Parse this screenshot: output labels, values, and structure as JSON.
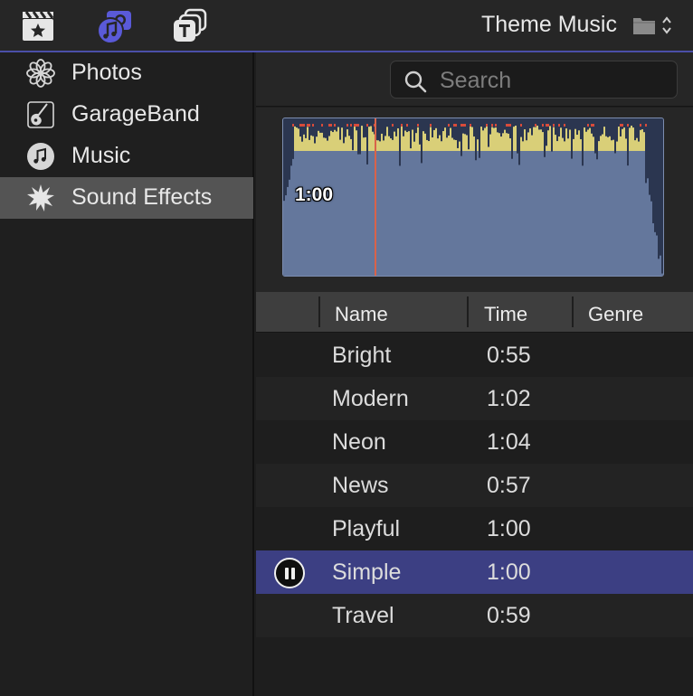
{
  "toolbar": {
    "tabs": [
      {
        "name": "movies-tab",
        "icon": "clapperboard-icon",
        "active": false
      },
      {
        "name": "audio-photos-tab",
        "icon": "camera-music-icon",
        "active": true
      },
      {
        "name": "titles-tab",
        "icon": "titles-icon",
        "active": false
      }
    ],
    "browser_title": "Theme Music",
    "folder_icon": "folder-icon",
    "accent_color": "#5a5ad8"
  },
  "sidebar": {
    "items": [
      {
        "label": "Photos",
        "icon": "flower-icon",
        "selected": false
      },
      {
        "label": "GarageBand",
        "icon": "guitar-icon",
        "selected": false
      },
      {
        "label": "Music",
        "icon": "music-note-icon",
        "selected": false
      },
      {
        "label": "Sound Effects",
        "icon": "burst-icon",
        "selected": true
      }
    ]
  },
  "search": {
    "placeholder": "Search",
    "value": ""
  },
  "preview": {
    "duration": "1:00",
    "playhead_fraction": 0.24
  },
  "table": {
    "columns": [
      "Name",
      "Time",
      "Genre"
    ],
    "rows": [
      {
        "name": "Bright",
        "time": "0:55",
        "genre": ""
      },
      {
        "name": "Modern",
        "time": "1:02",
        "genre": ""
      },
      {
        "name": "Neon",
        "time": "1:04",
        "genre": ""
      },
      {
        "name": "News",
        "time": "0:57",
        "genre": ""
      },
      {
        "name": "Playful",
        "time": "1:00",
        "genre": ""
      },
      {
        "name": "Simple",
        "time": "1:00",
        "genre": "",
        "selected": true,
        "playing": true
      },
      {
        "name": "Travel",
        "time": "0:59",
        "genre": ""
      }
    ]
  }
}
